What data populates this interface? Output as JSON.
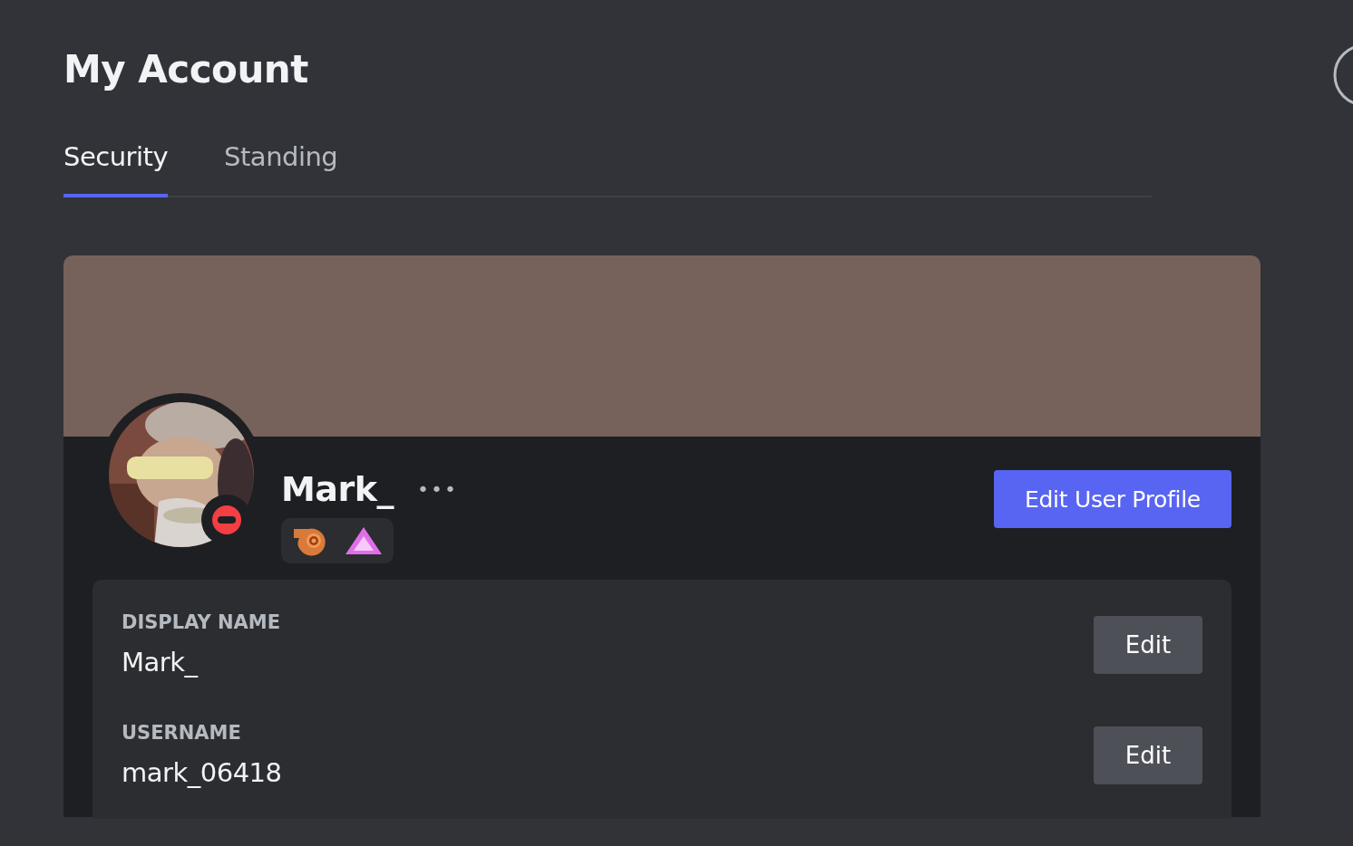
{
  "page": {
    "title": "My Account"
  },
  "tabs": [
    {
      "label": "Security",
      "selected": true
    },
    {
      "label": "Standing",
      "selected": false
    }
  ],
  "profile": {
    "name": "Mark_",
    "more": "•••",
    "do_not_disturb": true,
    "badges": [
      {
        "kind": "boost"
      },
      {
        "kind": "nitro"
      }
    ],
    "edit_button": "Edit User Profile"
  },
  "fields": [
    {
      "label": "DISPLAY NAME",
      "value": "Mark_",
      "button": "Edit"
    },
    {
      "label": "USERNAME",
      "value": "mark_06418",
      "button": "Edit"
    }
  ]
}
